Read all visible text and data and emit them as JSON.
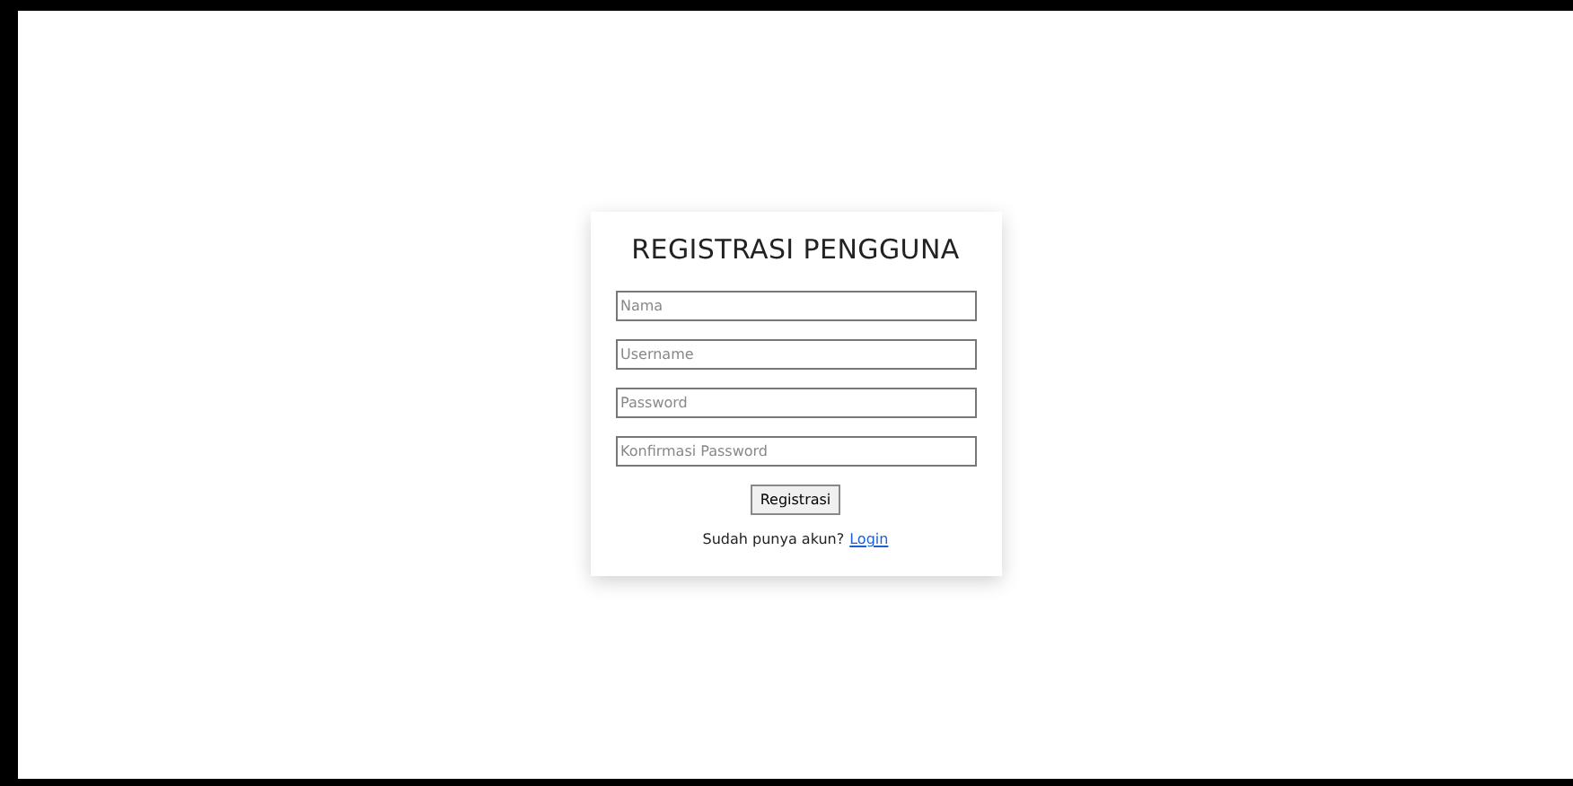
{
  "form": {
    "title": "REGISTRASI PENGGUNA",
    "fields": [
      {
        "placeholder": "Nama"
      },
      {
        "placeholder": "Username"
      },
      {
        "placeholder": "Password"
      },
      {
        "placeholder": "Konfirmasi Password"
      }
    ],
    "submit": "Registrasi",
    "footer_text": "Sudah punya akun?",
    "footer_link": "Login"
  }
}
